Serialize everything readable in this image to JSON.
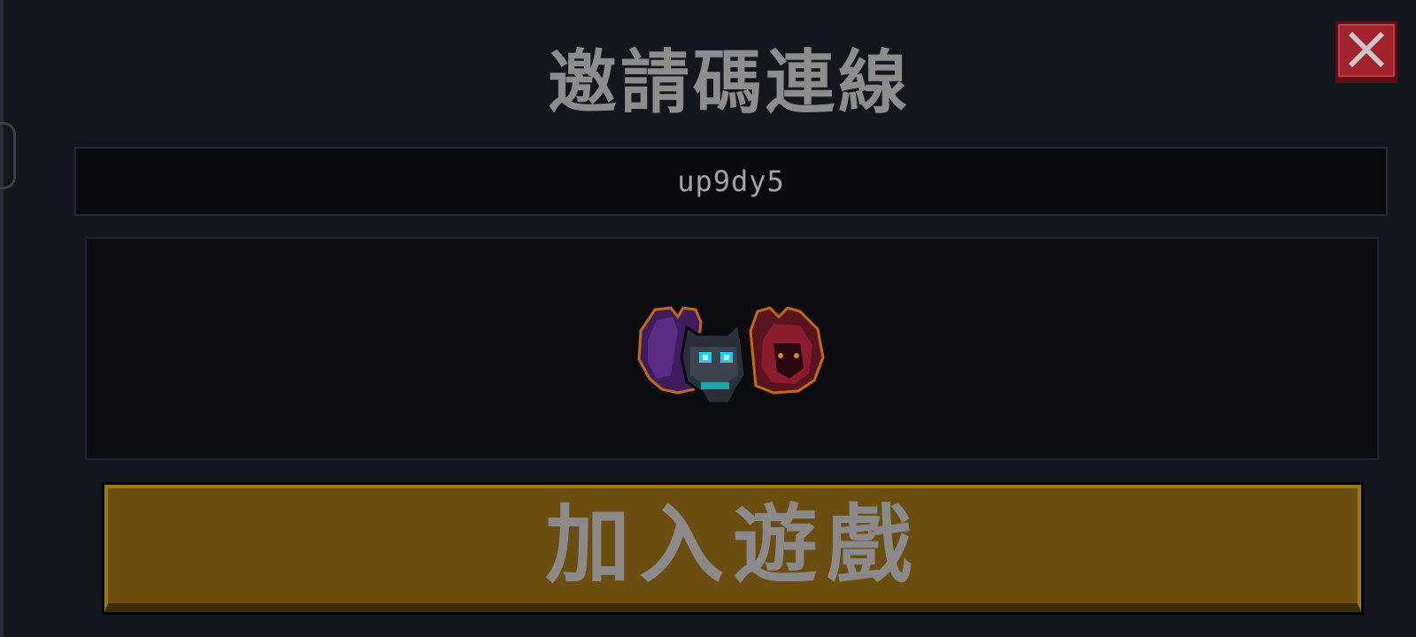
{
  "dialog": {
    "title": "邀請碼連線",
    "invite_code": "up9dy5",
    "join_label": "加入遊戲",
    "close_icon": "close-icon",
    "pet_icon": "pet-sprite-icon"
  },
  "colors": {
    "background": "#13161d",
    "close_button": "#a0232e",
    "join_button": "#6b4d10",
    "text": "#8d8d8d"
  }
}
